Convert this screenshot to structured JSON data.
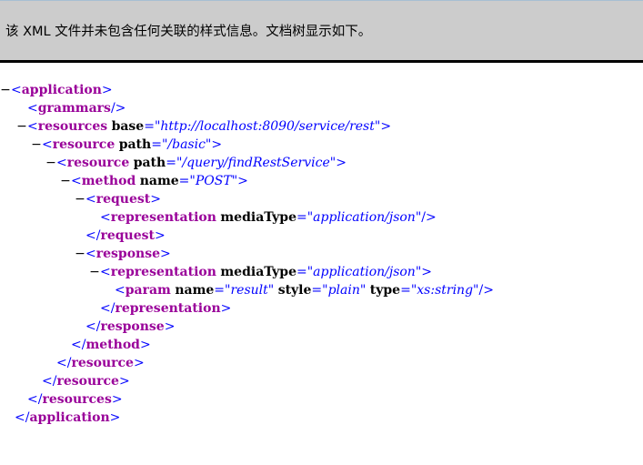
{
  "notice": {
    "message": "该 XML 文件并未包含任何关联的样式信息。文档树显示如下。"
  },
  "tree": {
    "toggle": "−",
    "open": "<",
    "close": ">",
    "end_open": "</",
    "self_close": "/>",
    "eq": "=",
    "q": "\"",
    "application": "application",
    "grammars": "grammars",
    "resources": "resources",
    "resource": "resource",
    "method": "method",
    "request": "request",
    "response": "response",
    "representation": "representation",
    "param": "param",
    "base_attr": "base",
    "base_value": "http://localhost:8090/service/rest",
    "path_attr": "path",
    "path_value_1": "/basic",
    "path_value_2": "/query/findRestService",
    "name_attr": "name",
    "method_name_value": "POST",
    "mediatype_attr": "mediaType",
    "mediatype_value": "application/json",
    "param_name_value": "result",
    "style_attr": "style",
    "style_value": "plain",
    "type_attr": "type",
    "type_value": "xs:string"
  }
}
